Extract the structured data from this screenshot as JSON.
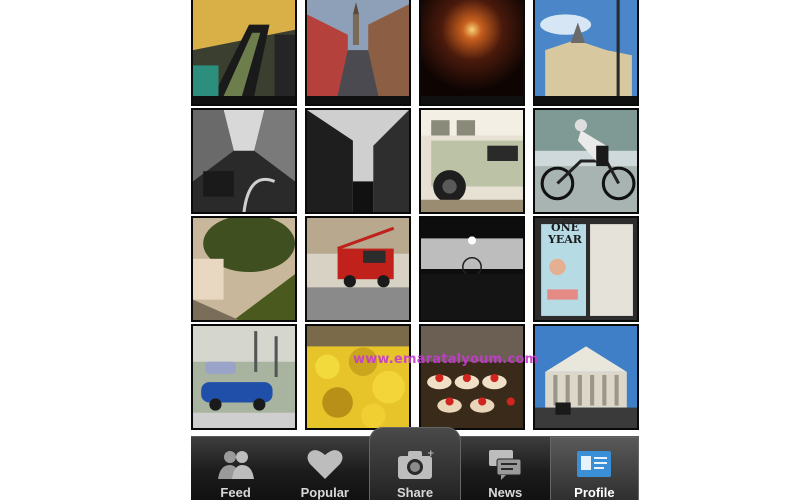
{
  "grid": {
    "photos": [
      {
        "name": "photo-escalator"
      },
      {
        "name": "photo-city-street"
      },
      {
        "name": "photo-tunnel"
      },
      {
        "name": "photo-building-blue-sky"
      },
      {
        "name": "photo-tram-interior"
      },
      {
        "name": "photo-street-bw"
      },
      {
        "name": "photo-land-rover"
      },
      {
        "name": "photo-cyclist"
      },
      {
        "name": "photo-tree-house"
      },
      {
        "name": "photo-fire-truck"
      },
      {
        "name": "photo-ferris-wheel"
      },
      {
        "name": "photo-poster"
      },
      {
        "name": "photo-red-bull-car"
      },
      {
        "name": "photo-yellow-flowers"
      },
      {
        "name": "photo-cakes"
      },
      {
        "name": "photo-parliament"
      }
    ]
  },
  "poster_text": {
    "line1": "ONE",
    "line2": "YEAR"
  },
  "watermark": "www.emaratalyoum.com",
  "tabbar": {
    "tabs": [
      {
        "id": "feed",
        "label": "Feed",
        "icon": "people-icon"
      },
      {
        "id": "popular",
        "label": "Popular",
        "icon": "heart-icon"
      },
      {
        "id": "share",
        "label": "Share",
        "icon": "camera-icon"
      },
      {
        "id": "news",
        "label": "News",
        "icon": "speech-bubbles-icon"
      },
      {
        "id": "profile",
        "label": "Profile",
        "icon": "profile-card-icon"
      }
    ],
    "active": "profile",
    "active_color": "#3a8fd6"
  }
}
